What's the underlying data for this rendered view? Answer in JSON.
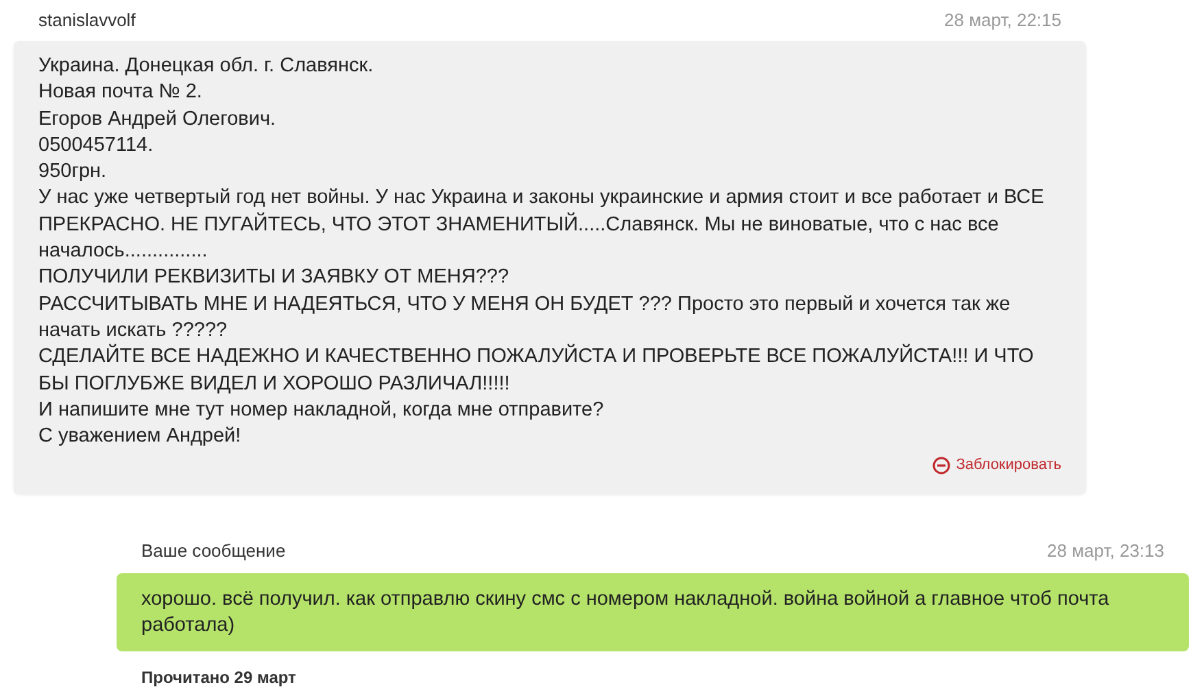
{
  "messages": [
    {
      "kind": "incoming",
      "author": "stanislavvolf",
      "time": "28 март, 22:15",
      "paragraphs": [
        "Украина. Донецкая обл. г. Славянск.",
        "Новая почта № 2.",
        "Егоров Андрей Олегович.",
        "0500457114.",
        "950грн.",
        "У нас уже четвертый год нет войны. У нас Украина и законы украинские и армия стоит и все работает и ВСЕ ПРЕКРАСНО. НЕ ПУГАЙТЕСЬ, ЧТО ЭТОТ ЗНАМЕНИТЫЙ.....Славянск. Мы не виноватые, что с нас все началось...............",
        "ПОЛУЧИЛИ РЕКВИЗИТЫ И ЗАЯВКУ ОТ МЕНЯ???",
        "РАССЧИТЫВАТЬ МНЕ И НАДЕЯТЬСЯ, ЧТО У МЕНЯ ОН БУДЕТ ??? Просто это первый и хочется так же начать искать ?????",
        "СДЕЛАЙТЕ ВСЕ НАДЕЖНО И КАЧЕСТВЕННО ПОЖАЛУЙСТА И ПРОВЕРЬТЕ ВСЕ ПОЖАЛУЙСТА!!! И ЧТО БЫ ПОГЛУБЖЕ ВИДЕЛ И ХОРОШО РАЗЛИЧАЛ!!!!!",
        "И напишите мне тут номер накладной, когда мне отправите?",
        "С уважением Андрей!"
      ],
      "block_label": "Заблокировать"
    },
    {
      "kind": "outgoing",
      "author": "Ваше сообщение",
      "time": "28 март, 23:13",
      "paragraphs": [
        "хорошо. всё получил. как отправлю скину смс с номером накладной. война войной а главное чтоб почта работала)"
      ],
      "read_status": "Прочитано 29 март"
    }
  ]
}
